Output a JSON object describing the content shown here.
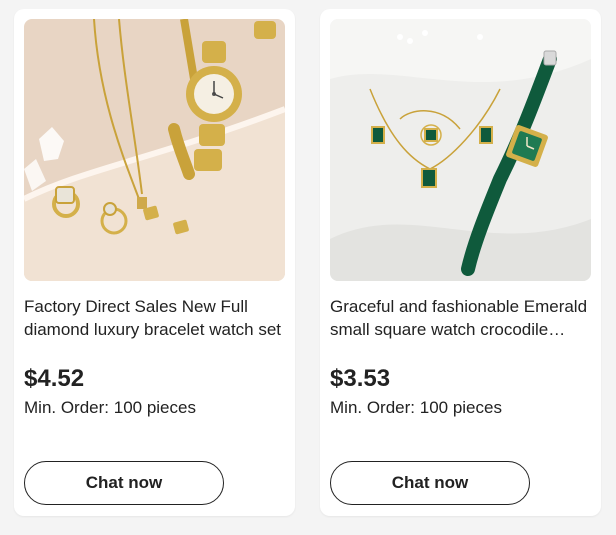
{
  "products": [
    {
      "title": "Factory Direct Sales New Full diamond luxury bracelet watch set",
      "price": "$4.52",
      "min_order": "Min. Order: 100 pieces",
      "cta": "Chat now"
    },
    {
      "title": "Graceful and fashionable Emerald small square watch crocodile leather strap set",
      "price": "$3.53",
      "min_order": "Min. Order: 100 pieces",
      "cta": "Chat now"
    }
  ],
  "colors": {
    "page_bg": "#f4f4f4",
    "card_bg": "#ffffff",
    "text": "#222222",
    "gold": "#d4b04a",
    "emerald": "#0f5a3c"
  }
}
